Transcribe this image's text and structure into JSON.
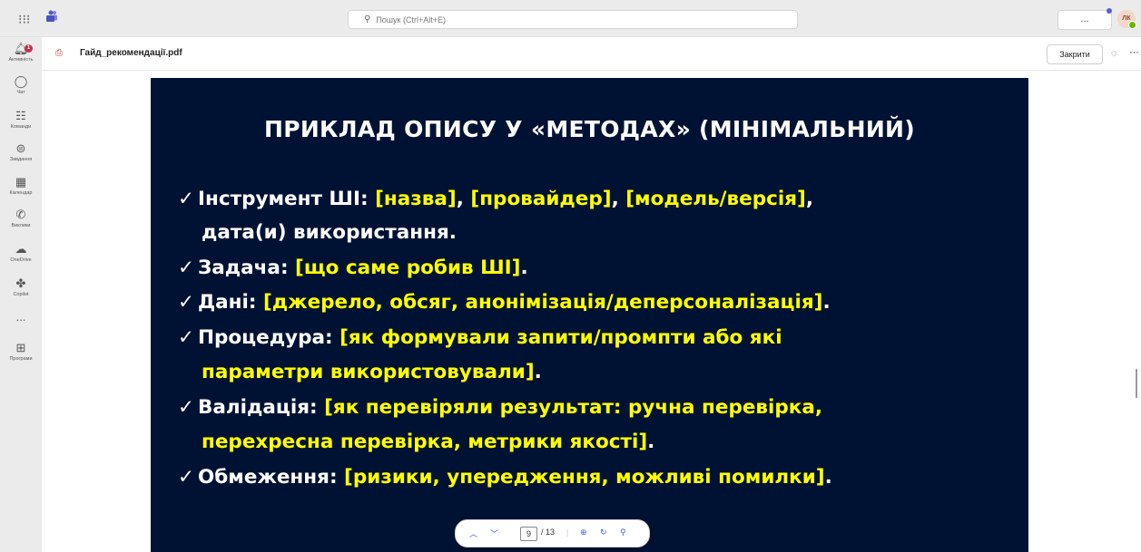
{
  "search": {
    "placeholder": "Пошук (Ctrl+Alt+E)"
  },
  "topbar": {
    "more_label": "...",
    "avatar_initials": "ЛК"
  },
  "rail": {
    "items": [
      {
        "label": "Активність",
        "icon": "bell-icon",
        "badge": "1"
      },
      {
        "label": "Чат",
        "icon": "chat-icon"
      },
      {
        "label": "Команди",
        "icon": "teams-icon"
      },
      {
        "label": "Завдання",
        "icon": "tasks-icon"
      },
      {
        "label": "Календар",
        "icon": "calendar-icon"
      },
      {
        "label": "Виклики",
        "icon": "phone-icon"
      },
      {
        "label": "OneDrive",
        "icon": "cloud-icon"
      },
      {
        "label": "Copilot",
        "icon": "copilot-icon"
      },
      {
        "label": "...",
        "icon": "more-icon"
      },
      {
        "label": "Програми",
        "icon": "apps-icon"
      }
    ]
  },
  "file": {
    "name": "Гайд_рекомендації.pdf",
    "close_label": "Закрити"
  },
  "slide": {
    "title": "ПРИКЛАД ОПИСУ У «МЕТОДАХ» (МІНІМАЛЬНИЙ)",
    "check": "✓",
    "l1_w": "Інструмент ШІ: ",
    "l1_y1": "[назва]",
    "l1_sep1": ", ",
    "l1_y2": "[провайдер]",
    "l1_sep2": ", ",
    "l1_y3": "[модель/версія]",
    "l1_end": ",",
    "l1b": "дата(и) використання.",
    "l2_w": "Задача: ",
    "l2_y": "[що саме робив ШІ]",
    "l2_end": ".",
    "l3_w": "Дані: ",
    "l3_y": "[джерело, обсяг, анонімізація/деперсоналізація]",
    "l3_end": ".",
    "l4_w": "Процедура: ",
    "l4_y": "[як формували запити/промпти або які",
    "l4b_y": "параметри використовували]",
    "l4b_end": ".",
    "l5_w": "Валідація: ",
    "l5_y": "[як перевіряли результат: ручна перевірка,",
    "l5b_y": "перехресна перевірка, метрики якості]",
    "l5b_end": ".",
    "l6_w": "Обмеження: ",
    "l6_y": "[ризики, упередження, можливі помилки]",
    "l6_end": "."
  },
  "pager": {
    "current_page": "9",
    "total": "/ 13"
  }
}
